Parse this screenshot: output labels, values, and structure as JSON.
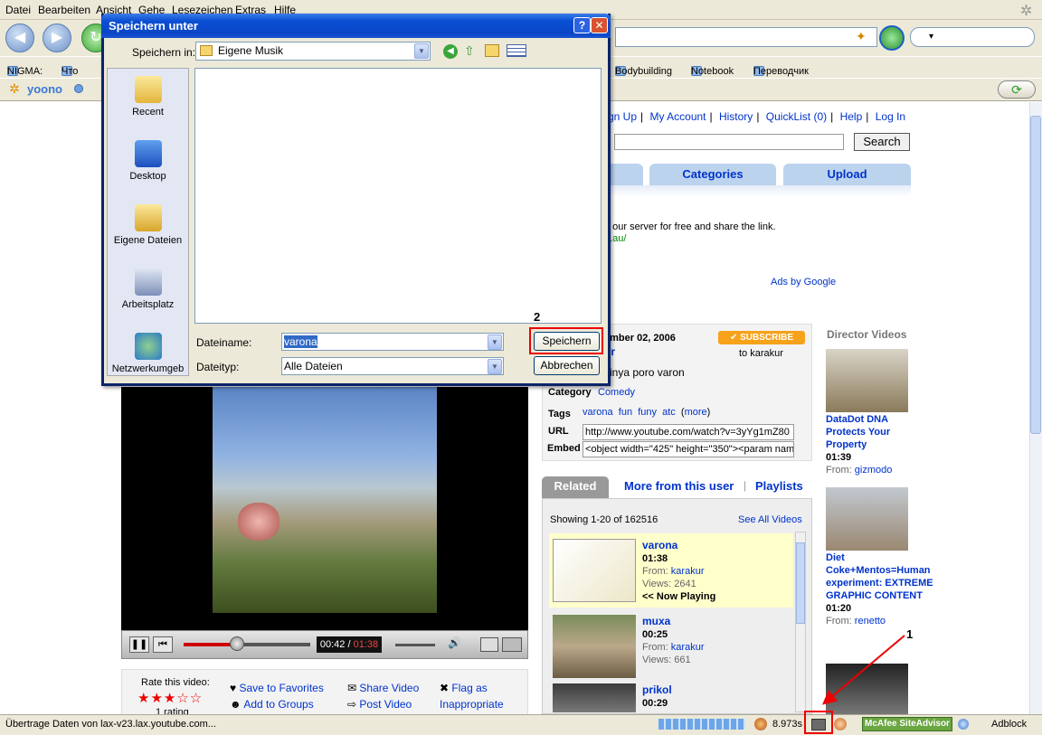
{
  "menu": {
    "items": [
      "Datei",
      "Bearbeiten",
      "Ansicht",
      "Gehe",
      "Lesezeichen",
      "Extras",
      "Hilfe"
    ]
  },
  "bookmarks": {
    "nigma": "NIGMA:",
    "chto": "Что н",
    "bodybuilding": "Bodybuilding",
    "notebook": "Notebook",
    "perevodchik": "Переводчик"
  },
  "yoono": {
    "logo": "yoono"
  },
  "youtube": {
    "toplinks": [
      "gn Up",
      "My Account",
      "History",
      "QuickList (0)",
      "Help",
      "Log In"
    ],
    "search_button": "Search",
    "tabs": [
      "Categories",
      "Upload"
    ],
    "ad_lines": [
      "g",
      "o our server for free and share the link.",
      "n.au/"
    ],
    "ads_by": "Ads by Google",
    "date": "ember 02, 2006",
    "author_frag": "ur",
    "subscribe": "SUBSCRIBE",
    "subscribe_to": "to karakur",
    "description": "sinya poro varon",
    "category_label": "Category",
    "category": "Comedy",
    "tags_label": "Tags",
    "tags": [
      "varona",
      "fun",
      "funy",
      "atc",
      "more"
    ],
    "url_label": "URL",
    "url_value": "http://www.youtube.com/watch?v=3yYg1mZ80",
    "embed_label": "Embed",
    "embed_value": "<object width=\"425\" height=\"350\"><param name",
    "related_tab": "Related",
    "more_from_user": "More from this user",
    "playlists": "Playlists",
    "showing": "Showing 1-20 of 162516",
    "see_all": "See All Videos",
    "related": [
      {
        "title": "varona",
        "duration": "01:38",
        "from": "karakur",
        "views": "Views: 2641",
        "now": "<< Now Playing"
      },
      {
        "title": "muxa",
        "duration": "00:25",
        "from": "karakur",
        "views": "Views: 661",
        "now": ""
      },
      {
        "title": "prikol",
        "duration": "00:29",
        "from": "",
        "views": "",
        "now": ""
      }
    ],
    "from_label": "From:",
    "director_head": "Director Videos",
    "director": [
      {
        "title": "DataDot DNA Protects Your Property",
        "duration": "01:39",
        "from": "gizmodo"
      },
      {
        "title": "Diet Coke+Mentos=Human experiment: EXTREME GRAPHIC CONTENT",
        "duration": "01:20",
        "from": "renetto"
      }
    ],
    "time_current": "00:42",
    "time_total": "01:38",
    "progress": 0.43,
    "rate_label": "Rate this video:",
    "stars": "★★★☆☆",
    "rating_count": "1 rating",
    "actions": [
      "Save to Favorites",
      "Share Video",
      "Flag as",
      "Add to Groups",
      "Post Video",
      "Inappropriate"
    ]
  },
  "dialog": {
    "title": "Speichern unter",
    "save_in_label": "Speichern in:",
    "save_in_value": "Eigene Musik",
    "places": [
      "Recent",
      "Desktop",
      "Eigene Dateien",
      "Arbeitsplatz",
      "Netzwerkumgeb"
    ],
    "filename_label": "Dateiname:",
    "filename_value": "varona",
    "filetype_label": "Dateityp:",
    "filetype_value": "Alle Dateien",
    "save_button": "Speichern",
    "cancel_button": "Abbrechen",
    "callout": "2"
  },
  "status": {
    "text": "Übertrage Daten von lax-v23.lax.youtube.com...",
    "timer": "8.973s",
    "mcafee": "McAfee SiteAdvisor",
    "adblock": "Adblock",
    "callout": "1"
  },
  "colors": {
    "xp_blue": "#0a4fd4",
    "link": "#0033cc",
    "highlight": "#e00000"
  }
}
